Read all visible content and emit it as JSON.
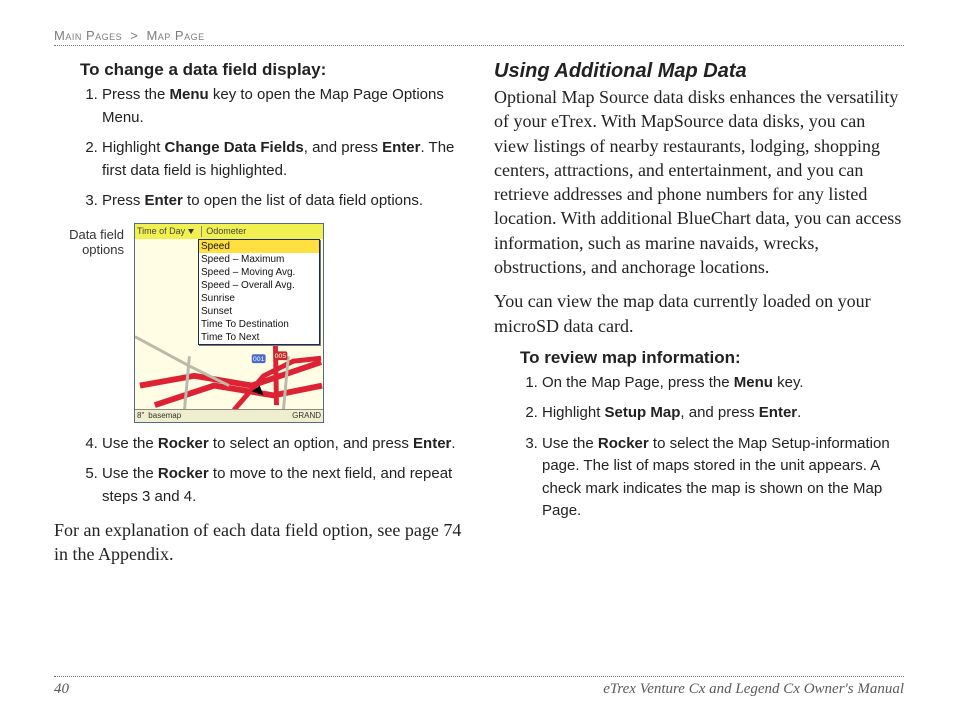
{
  "breadcrumb": {
    "a": "Main Pages",
    "sep": ">",
    "b": "Map Page"
  },
  "left": {
    "heading": "To change a data field display:",
    "step1": {
      "pre": "Press the ",
      "b1": "Menu",
      "post": " key to open the Map Page Options Menu."
    },
    "step2": {
      "pre": "Highlight ",
      "b1": "Change Data Fields",
      "mid": ", and press ",
      "b2": "Enter",
      "post": ". The first data field is highlighted."
    },
    "step3": {
      "pre": "Press ",
      "b1": "Enter",
      "post": " to open the list of data field options."
    },
    "caption1": "Data field",
    "caption2": "options",
    "device": {
      "hdr_left": "Time of Day",
      "hdr_right": "Odometer",
      "options": [
        "Speed",
        "Speed – Maximum",
        "Speed – Moving Avg.",
        "Speed – Overall Avg.",
        "Sunrise",
        "Sunset",
        "Time To Destination",
        "Time To Next"
      ],
      "status_left": "8\"",
      "status_mid": "basemap",
      "status_right": "GRAND"
    },
    "step4": {
      "pre": "Use the ",
      "b1": "Rocker",
      "mid": " to select an option, and press ",
      "b2": "Enter",
      "post": "."
    },
    "step5": {
      "pre": "Use the ",
      "b1": "Rocker",
      "post": " to move to the next field, and repeat steps 3 and 4."
    },
    "tailpara": "For an explanation of each data field option, see page 74 in the Appendix."
  },
  "right": {
    "subhead": "Using Additional Map Data",
    "para1": "Optional Map Source data disks enhances the versatility of your eTrex. With MapSource data disks, you can view listings of nearby restaurants, lodging, shopping centers, attractions, and entertainment, and you can retrieve addresses and phone numbers for any listed location. With additional BlueChart data, you can access information, such as marine navaids, wrecks, obstructions, and anchorage locations.",
    "para2": "You can view the map data currently loaded on your microSD data card.",
    "heading2": "To review map information:",
    "r1": {
      "pre": "On the Map Page, press the ",
      "b1": "Menu",
      "post": " key."
    },
    "r2": {
      "pre": "Highlight ",
      "b1": "Setup Map",
      "mid": ", and press ",
      "b2": "Enter",
      "post": "."
    },
    "r3": {
      "pre": "Use the ",
      "b1": "Rocker",
      "post": " to select the Map Setup-information page. The list of maps stored in the unit appears. A check mark indicates the map is shown on the Map Page."
    }
  },
  "footer": {
    "page": "40",
    "title": "eTrex Venture Cx and Legend Cx Owner's Manual"
  }
}
